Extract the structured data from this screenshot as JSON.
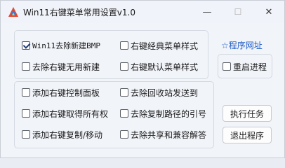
{
  "window": {
    "title": "Win11右键菜单常用设置v1.0",
    "minimize_glyph": "—",
    "maximize_glyph": "☐",
    "close_glyph": "✕"
  },
  "group1": {
    "items": [
      {
        "label": "Win11去除新建BMP",
        "checked": true
      },
      {
        "label": "右键经典菜单样式",
        "checked": false
      },
      {
        "label": "去除右键无用新建",
        "checked": false
      },
      {
        "label": "右键默认菜单样式",
        "checked": false
      }
    ]
  },
  "side": {
    "link_label": "☆程序网址",
    "restart_label": "重启进程",
    "restart_checked": false
  },
  "group2": {
    "items": [
      {
        "label": "添加右键控制面板",
        "checked": false
      },
      {
        "label": "去除回收站发送到",
        "checked": false
      },
      {
        "label": "添加右键取得所有权",
        "checked": false
      },
      {
        "label": "去除复制路径的引号",
        "checked": false
      },
      {
        "label": "添加右键复制/移动",
        "checked": false
      },
      {
        "label": "去除共享和兼容解答",
        "checked": false
      }
    ]
  },
  "buttons": {
    "execute_label": "执行任务",
    "exit_label": "退出程序"
  },
  "colors": {
    "link": "#1e5bc6",
    "window_bg": "#f1f4f9"
  }
}
